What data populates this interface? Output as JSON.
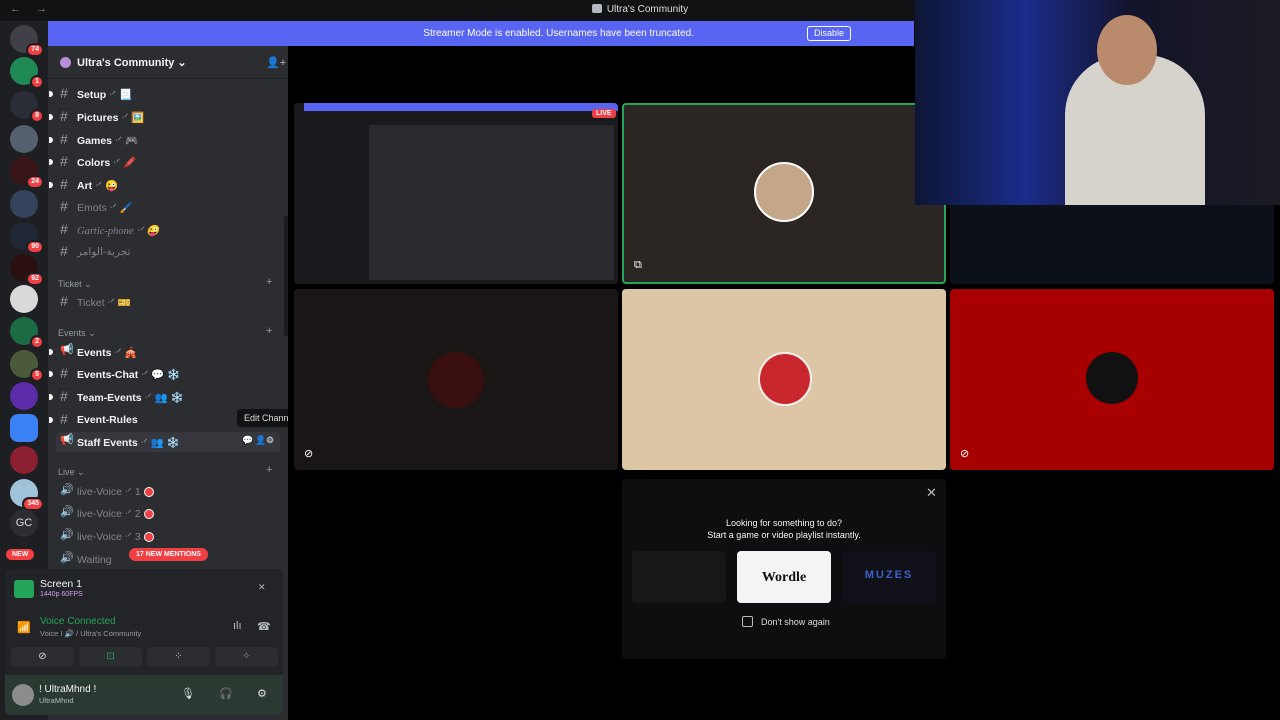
{
  "window": {
    "nav": "← →",
    "title": "Ultra's Community"
  },
  "guilds": [
    {
      "badge": "74"
    },
    {
      "badge": "1"
    },
    {
      "badge": "8"
    },
    {
      "badge": ""
    },
    {
      "badge": "24"
    },
    {
      "badge": ""
    },
    {
      "badge": "90"
    },
    {
      "badge": "92"
    },
    {
      "badge": ""
    },
    {
      "badge": "2"
    },
    {
      "badge": "5"
    },
    {
      "badge": ""
    },
    {
      "badge": ""
    },
    {
      "badge": ""
    },
    {
      "badge": "345"
    }
  ],
  "guild_gc": "GC",
  "guild_new": "NEW",
  "banner": {
    "message": "Streamer Mode is enabled. Usernames have been truncated.",
    "button": "Disable"
  },
  "server": {
    "name": "Ultra's Community ⌄"
  },
  "channels": {
    "setup": {
      "name": "Setup",
      "suffix": " ᐧᐟ 📃"
    },
    "pictures": {
      "name": "Pictures",
      "suffix": " ᐧᐟ 🖼️"
    },
    "games": {
      "name": "Games",
      "suffix": " ᐧᐟ 🎮"
    },
    "colors": {
      "name": "Colors",
      "suffix": " ᐧᐟ 🖍️"
    },
    "art": {
      "name": "Art",
      "suffix": " ᐧᐟ 😜"
    },
    "emots": {
      "name": "Emots",
      "suffix": " ᐧᐟ 🖌️"
    },
    "gartic": {
      "name": "Gartic-phone",
      "suffix": " ᐧᐟ 😜"
    },
    "arabic": {
      "name": "تجربة-الوامر",
      "suffix": ""
    },
    "ticket": {
      "name": "Ticket",
      "suffix": " ᐧᐟ 🎫"
    },
    "events": {
      "name": "Events",
      "suffix": " ᐧᐟ 🎪"
    },
    "events_chat": {
      "name": "Events-Chat",
      "suffix": " ᐧᐟ 💬 ❄️"
    },
    "team_events": {
      "name": "Team-Events",
      "suffix": " ᐧᐟ 👥 ❄️"
    },
    "event_rules": {
      "name": "Event-Rules",
      "suffix": ""
    },
    "staff_events": {
      "name": "Staff Events",
      "suffix": " ᐧᐟ 👥 ❄️"
    },
    "live1": {
      "name": "live-Voice",
      "suffix": " ᐧᐟ 1"
    },
    "live2": {
      "name": "live-Voice",
      "suffix": " ᐧᐟ 2"
    },
    "live3": {
      "name": "live-Voice",
      "suffix": " ᐧᐟ 3"
    },
    "waiting": {
      "name": "Waiting",
      "suffix": ""
    }
  },
  "categories": {
    "ticket": "Ticket ⌄",
    "events": "Events ⌄",
    "live": "Live ⌄"
  },
  "tooltip": "Edit Channel",
  "mentions_pill": "17 NEW MENTIONS",
  "panel": {
    "screen_title": "Screen 1",
    "screen_sub": "1440p 60FPS",
    "voice_status": "Voice Connected",
    "voice_detail": "Voice I 🔊 / Ultra's Community",
    "username": "! UltraMhnd !",
    "user_status": "UltraMhnd"
  },
  "activity": {
    "title": "Looking for something to do?",
    "subtitle": "Start a game or video playlist instantly.",
    "wordle": "Wordle",
    "muzes": "MUZES",
    "dont_show": "Don't show again"
  },
  "preview": {
    "live_badge": "LIVE"
  },
  "colors": {
    "blurple": "#5865f2",
    "green": "#23a55a",
    "red": "#f23f43",
    "beige": "#dcc6a6",
    "crimson": "#a80000"
  }
}
